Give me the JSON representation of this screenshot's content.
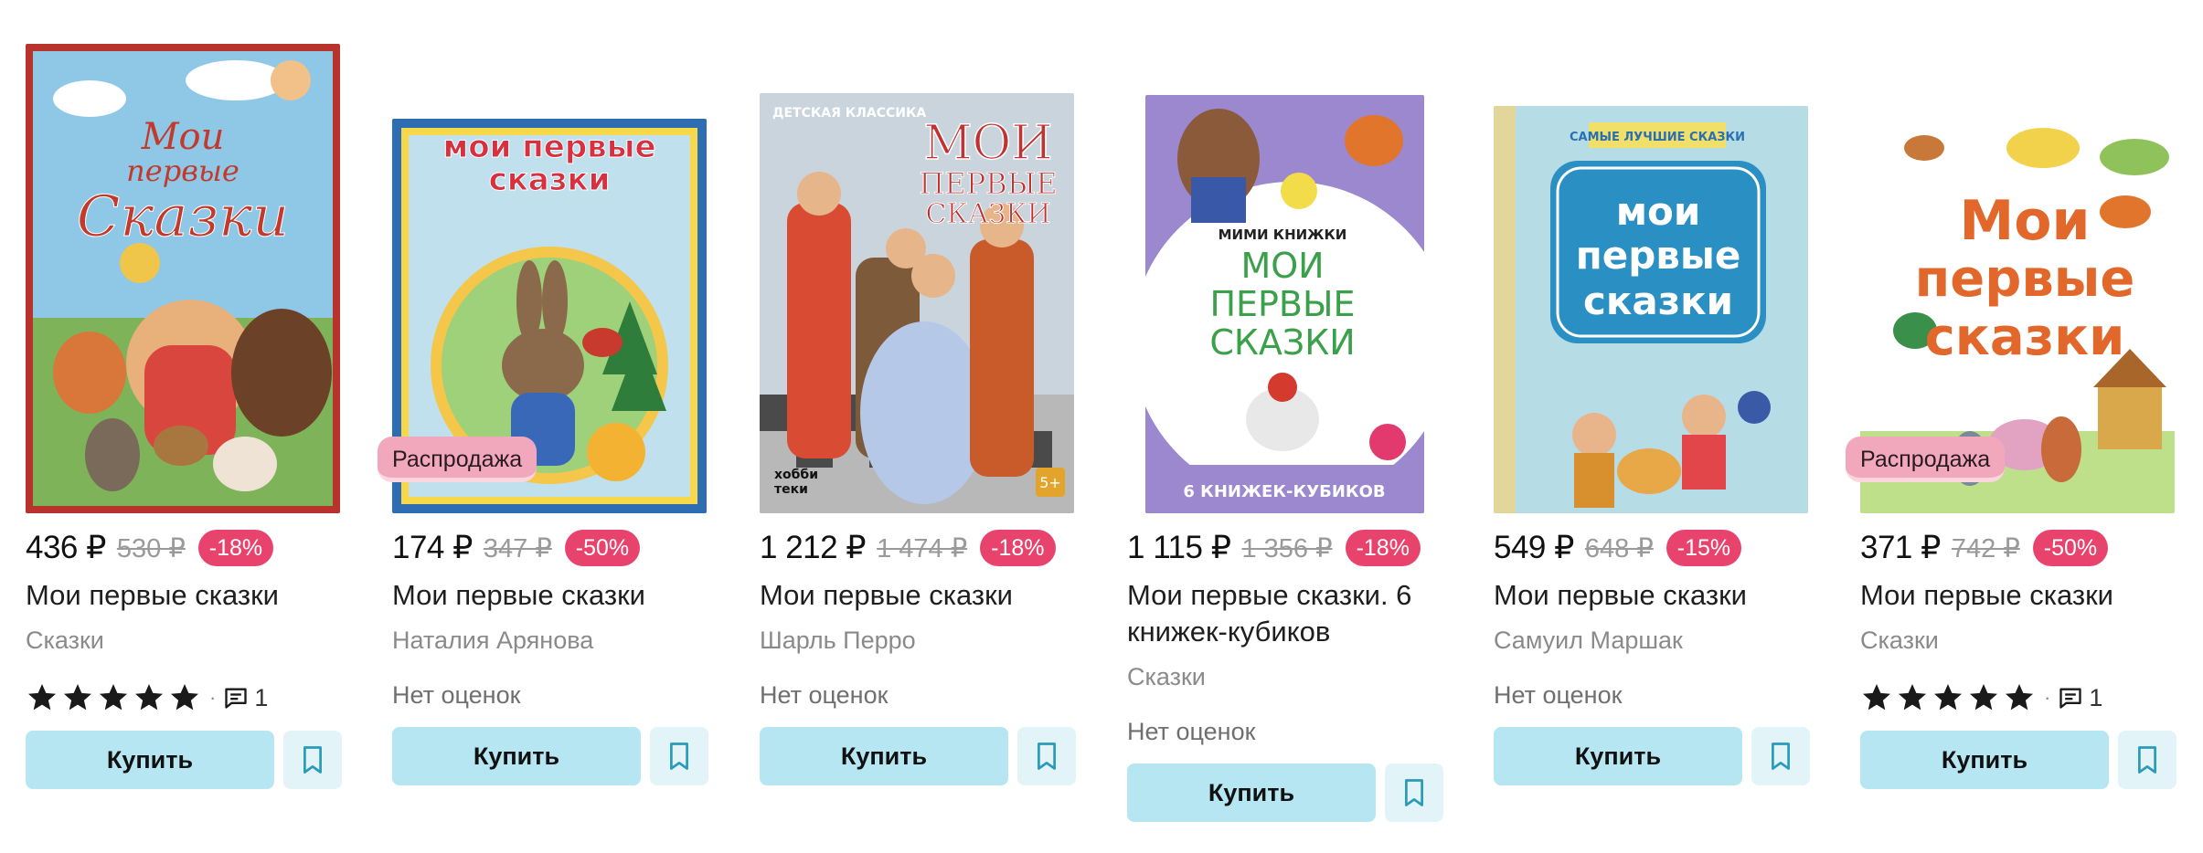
{
  "products": [
    {
      "cover_title": "Мои первые Сказки",
      "sale_badge": "",
      "price": "436 ₽",
      "old_price": "530 ₽",
      "discount": "-18%",
      "title": "Мои первые сказки",
      "subtitle": "Сказки",
      "rating_stars": 5,
      "review_count": "1",
      "no_rating": "",
      "buy_label": "Купить"
    },
    {
      "cover_title": "мои первые сказки",
      "sale_badge": "Распродажа",
      "price": "174 ₽",
      "old_price": "347 ₽",
      "discount": "-50%",
      "title": "Мои первые сказки",
      "subtitle": "Наталия Арянова",
      "rating_stars": 0,
      "review_count": "",
      "no_rating": "Нет оценок",
      "buy_label": "Купить"
    },
    {
      "cover_series": "ДЕТСКАЯ КЛАССИКА",
      "cover_title": "МОИ ПЕРВЫЕ СКАЗКИ",
      "cover_age": "5+",
      "cover_publisher": "хобби теки",
      "sale_badge": "",
      "price": "1 212 ₽",
      "old_price": "1 474 ₽",
      "discount": "-18%",
      "title": "Мои первые сказки",
      "subtitle": "Шарль Перро",
      "rating_stars": 0,
      "review_count": "",
      "no_rating": "Нет оценок",
      "buy_label": "Купить"
    },
    {
      "cover_series": "МИМИ КНИЖКИ",
      "cover_title": "МОИ ПЕРВЫЕ СКАЗКИ",
      "cover_footer": "6 КНИЖЕК-КУБИКОВ",
      "sale_badge": "",
      "price": "1 115 ₽",
      "old_price": "1 356 ₽",
      "discount": "-18%",
      "title": "Мои первые сказки. 6 книжек-кубиков",
      "subtitle": "Сказки",
      "rating_stars": 0,
      "review_count": "",
      "no_rating": "Нет оценок",
      "buy_label": "Купить"
    },
    {
      "cover_series": "САМЫЕ ЛУЧШИЕ СКАЗКИ",
      "cover_title": "мои первые сказки",
      "sale_badge": "",
      "price": "549 ₽",
      "old_price": "648 ₽",
      "discount": "-15%",
      "title": "Мои первые сказки",
      "subtitle": "Самуил Маршак",
      "rating_stars": 0,
      "review_count": "",
      "no_rating": "Нет оценок",
      "buy_label": "Купить"
    },
    {
      "cover_title": "Мои первые сказки",
      "sale_badge": "Распродажа",
      "price": "371 ₽",
      "old_price": "742 ₽",
      "discount": "-50%",
      "title": "Мои первые сказки",
      "subtitle": "Сказки",
      "rating_stars": 5,
      "review_count": "1",
      "no_rating": "",
      "buy_label": "Купить"
    }
  ],
  "colors": {
    "buy_button": "#b5e6f1",
    "bookmark_button": "#e3f4f8",
    "discount_badge": "#e8436d",
    "sale_badge": "#f2a8bc"
  },
  "icons": {
    "star": "star-icon",
    "comment": "comment-icon",
    "bookmark": "bookmark-icon"
  }
}
